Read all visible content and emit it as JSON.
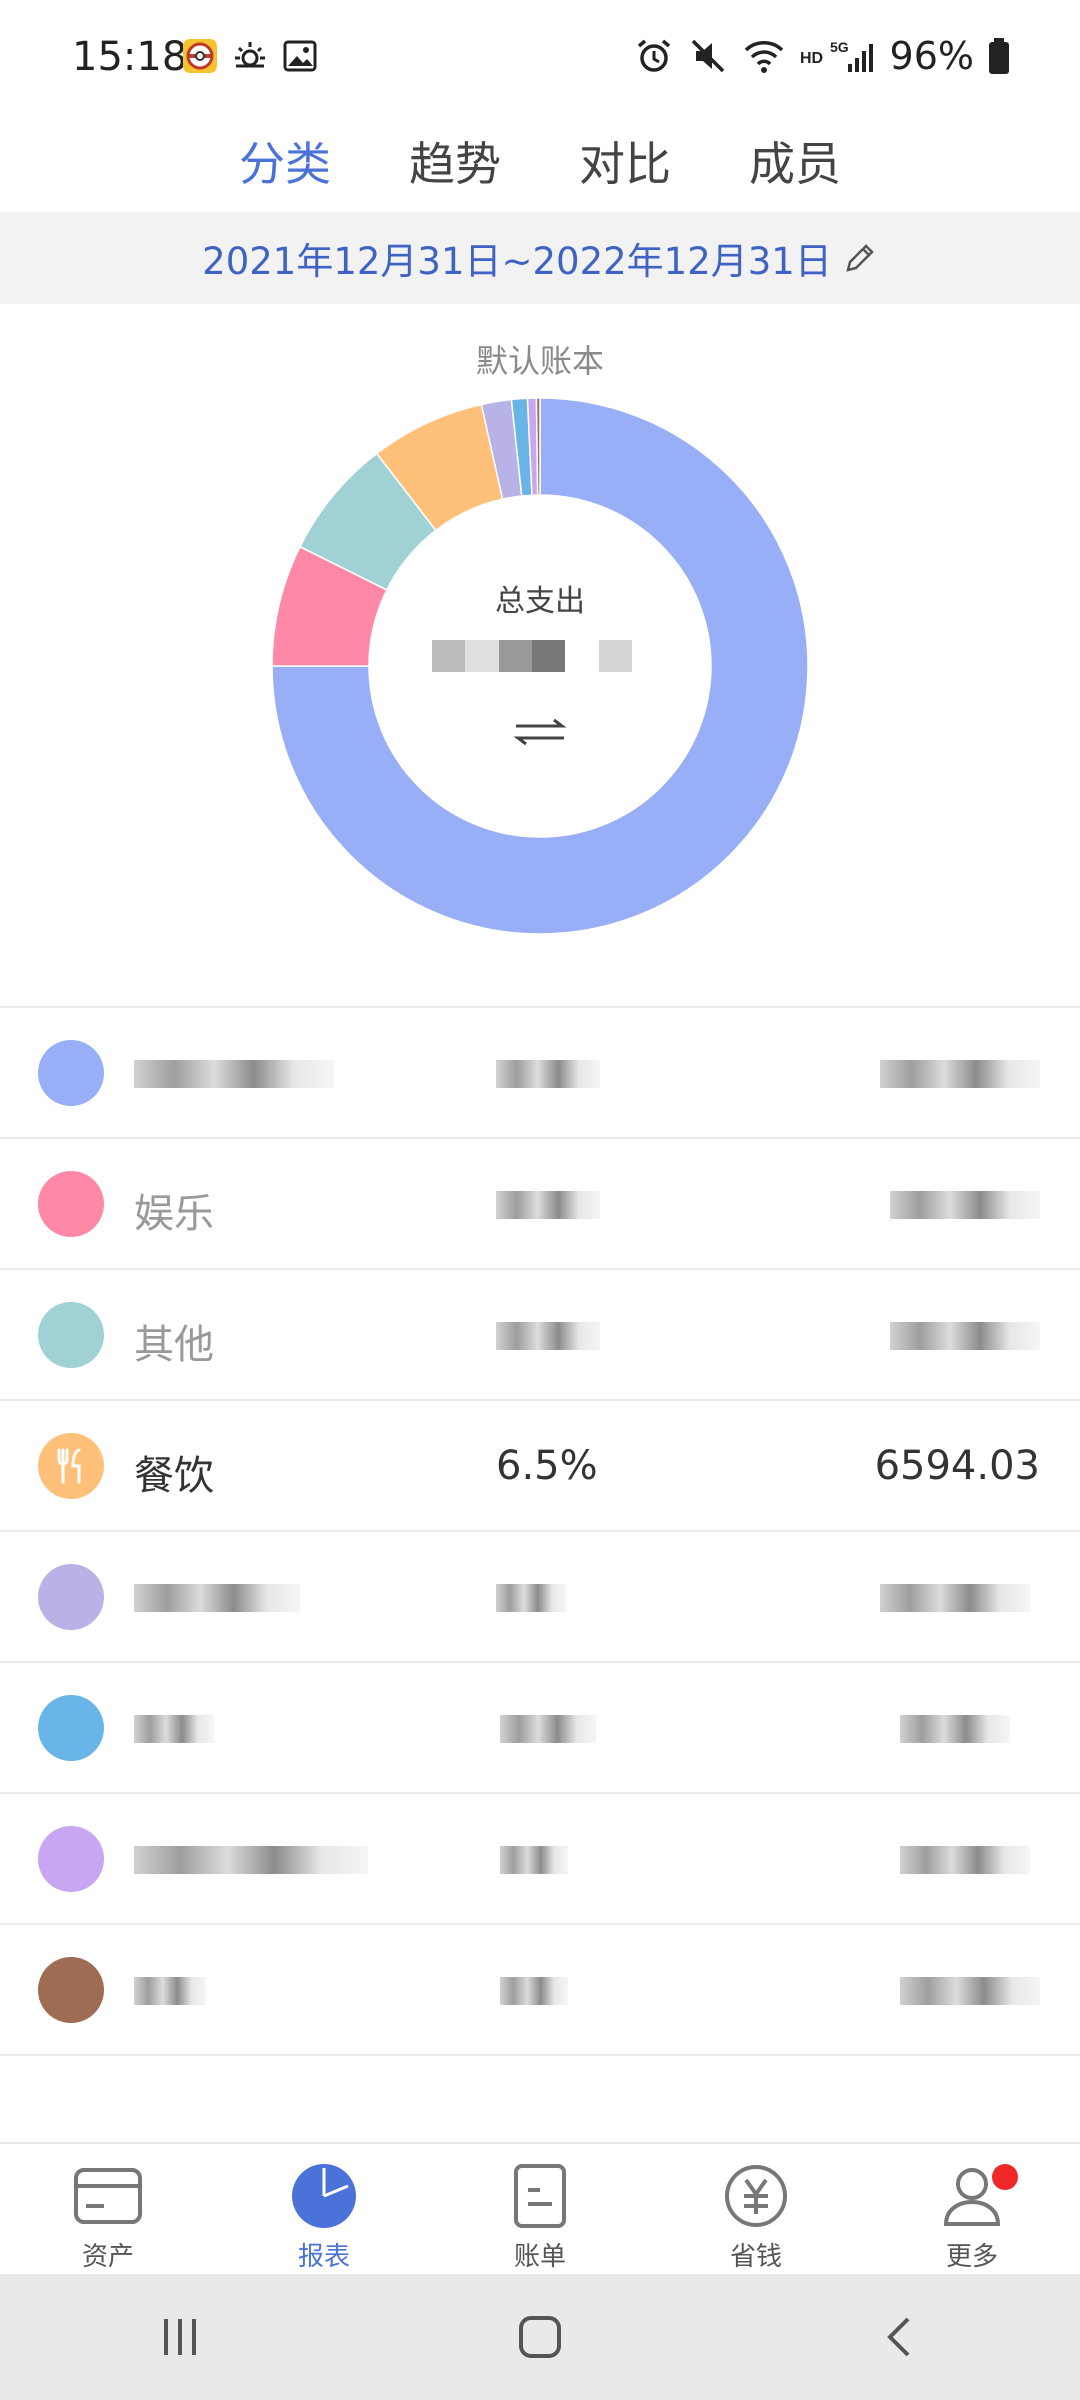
{
  "status_bar": {
    "time": "15:18",
    "battery": "96%"
  },
  "tabs": [
    {
      "label": "分类",
      "active": true
    },
    {
      "label": "趋势",
      "active": false
    },
    {
      "label": "对比",
      "active": false
    },
    {
      "label": "成员",
      "active": false
    }
  ],
  "date_range": "2021年12月31日~2022年12月31日",
  "chart": {
    "book_name": "默认账本",
    "center_label": "总支出",
    "center_amount": "••••••",
    "swap_icon": "swap-icon"
  },
  "chart_data": {
    "type": "pie",
    "donut": true,
    "slices": [
      {
        "label": "",
        "value": 70.5,
        "color": "#98aef6"
      },
      {
        "label": "娱乐",
        "value": 6.9,
        "color": "#ff88a6"
      },
      {
        "label": "其他",
        "value": 6.8,
        "color": "#9fd1d5"
      },
      {
        "label": "餐饮",
        "value": 6.5,
        "color": "#ffc07a"
      },
      {
        "label": "",
        "value": 1.7,
        "color": "#b9b2e6"
      },
      {
        "label": "",
        "value": 0.9,
        "color": "#69b5e8"
      },
      {
        "label": "",
        "value": 0.5,
        "color": "#c8a6f2"
      },
      {
        "label": "",
        "value": 0.2,
        "color": "#9e6b53"
      }
    ]
  },
  "categories": [
    {
      "name": "",
      "pct": "",
      "amount": "",
      "color": "#98aef6",
      "icon": "category-icon",
      "redacted": true
    },
    {
      "name": "娱乐",
      "pct": "",
      "amount": "",
      "color": "#ff88a6",
      "icon": "entertainment-icon",
      "redacted": true
    },
    {
      "name": "其他",
      "pct": "",
      "amount": "",
      "color": "#9fd1d5",
      "icon": "other-icon",
      "redacted": true
    },
    {
      "name": "餐饮",
      "pct": "6.5%",
      "amount": "6594.03",
      "color": "#ffc07a",
      "icon": "fork-knife-icon",
      "redacted": false
    },
    {
      "name": "",
      "pct": "",
      "amount": "",
      "color": "#b9b2e6",
      "icon": "category-icon",
      "redacted": true
    },
    {
      "name": "",
      "pct": "",
      "amount": "",
      "color": "#69b5e8",
      "icon": "category-icon",
      "redacted": true
    },
    {
      "name": "",
      "pct": "",
      "amount": "",
      "color": "#c8a6f2",
      "icon": "category-icon",
      "redacted": true
    },
    {
      "name": "",
      "pct": "",
      "amount": "",
      "color": "#9e6b53",
      "icon": "category-icon",
      "redacted": true
    }
  ],
  "bottom_nav": [
    {
      "label": "资产",
      "icon": "wallet-icon",
      "active": false
    },
    {
      "label": "报表",
      "icon": "pie-chart-icon",
      "active": true
    },
    {
      "label": "账单",
      "icon": "bill-icon",
      "active": false
    },
    {
      "label": "省钱",
      "icon": "yuan-icon",
      "active": false
    },
    {
      "label": "更多",
      "icon": "user-icon",
      "active": false,
      "badge": true
    }
  ],
  "colors": {
    "accent": "#4a72d8",
    "date_text": "#3f63c4",
    "badge": "#f02828"
  }
}
